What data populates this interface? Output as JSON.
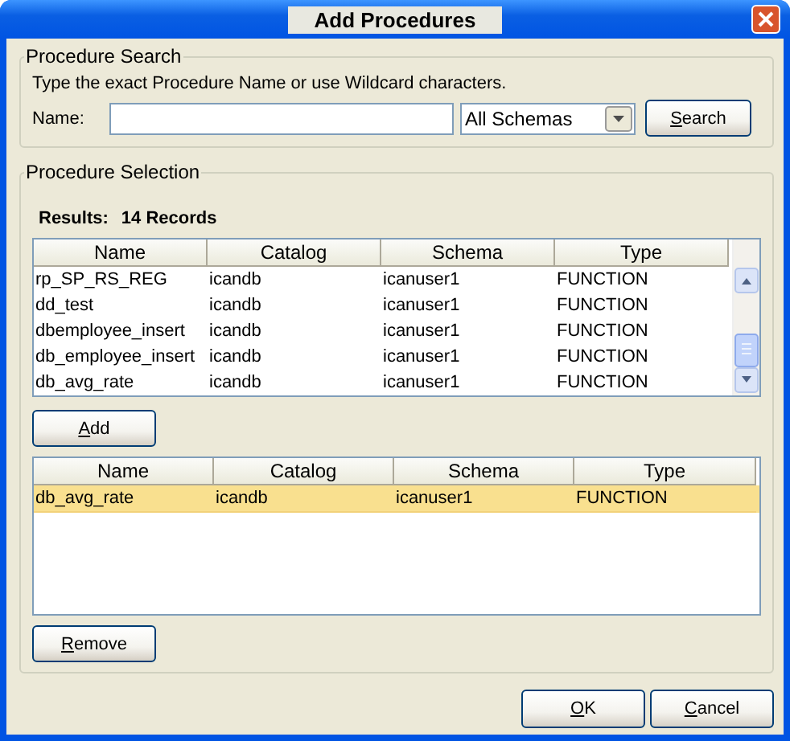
{
  "window": {
    "title": "Add Procedures"
  },
  "search_group": {
    "title": "Procedure Search",
    "hint": "Type the exact Procedure Name or use Wildcard characters.",
    "name_label": "Name:",
    "schema_dropdown": {
      "value": "All Schemas"
    },
    "search_button": {
      "label": "Search",
      "mnemonic_underlined": true
    }
  },
  "selection_group": {
    "title": "Procedure Selection",
    "results_label": "Results:",
    "results_count": "14 Records",
    "results_table": {
      "columns": [
        "Name",
        "Catalog",
        "Schema",
        "Type"
      ],
      "rows": [
        {
          "cells": [
            "rp_SP_RS_REG",
            "icandb",
            "icanuser1",
            "FUNCTION"
          ],
          "selected": false
        },
        {
          "cells": [
            "dd_test",
            "icandb",
            "icanuser1",
            "FUNCTION"
          ],
          "selected": false
        },
        {
          "cells": [
            "dbemployee_insert",
            "icandb",
            "icanuser1",
            "FUNCTION"
          ],
          "selected": false
        },
        {
          "cells": [
            "db_employee_insert",
            "icandb",
            "icanuser1",
            "FUNCTION"
          ],
          "selected": false
        },
        {
          "cells": [
            "db_avg_rate",
            "icandb",
            "icanuser1",
            "FUNCTION"
          ],
          "selected": false
        }
      ]
    },
    "add_button": {
      "label": "Add",
      "mnemonic_underlined": true
    },
    "selected_table": {
      "columns": [
        "Name",
        "Catalog",
        "Schema",
        "Type"
      ],
      "rows": [
        {
          "cells": [
            "db_avg_rate",
            "icandb",
            "icanuser1",
            "FUNCTION"
          ],
          "selected": true
        }
      ]
    },
    "remove_button": {
      "label": "Remove",
      "mnemonic_underlined": true
    }
  },
  "buttons": [
    {
      "label": "OK",
      "mnemonic_underlined": true
    },
    {
      "label": "Cancel",
      "mnemonic_underlined": true
    }
  ]
}
